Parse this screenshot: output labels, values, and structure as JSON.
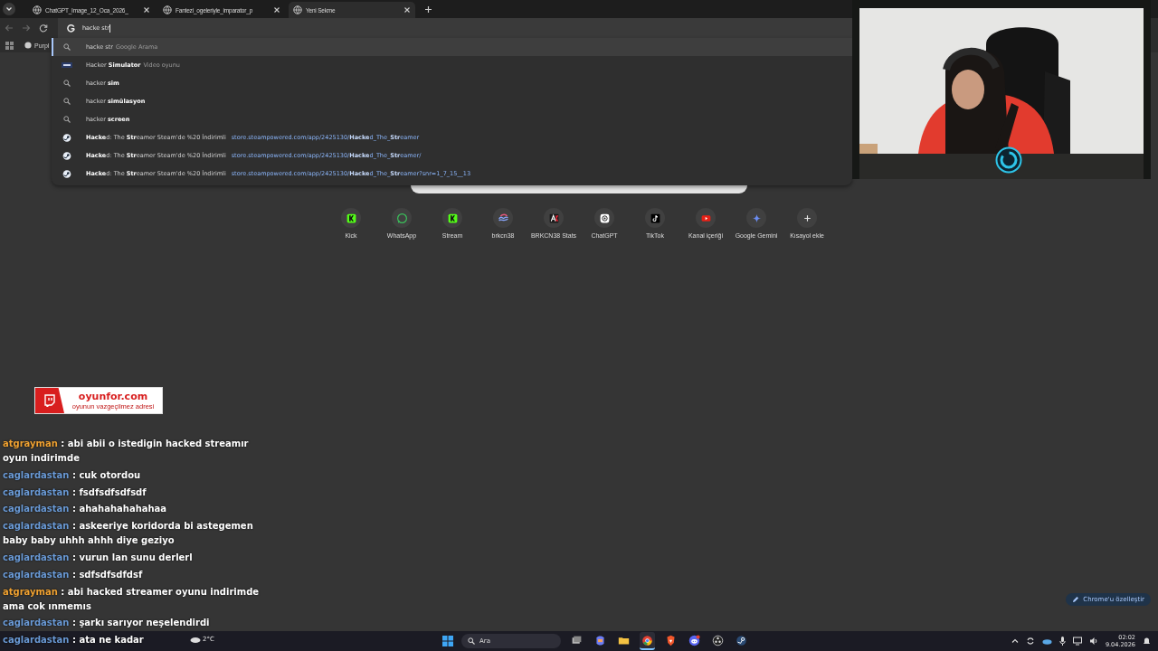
{
  "browser": {
    "tabs": [
      {
        "title": "ChatGPT_Image_12_Oca_2026_",
        "selected": false
      },
      {
        "title": "Fantezi_ogeleriyle_imparator_p",
        "selected": false
      },
      {
        "title": "Yeni Sekme",
        "selected": true
      }
    ],
    "omnibox": {
      "value": "hacke str"
    },
    "bookmarks": [
      {
        "label": "Purpl"
      }
    ],
    "suggestions": [
      {
        "kind": "search",
        "selected": true,
        "text": "hacke str",
        "detail": "Google Arama"
      },
      {
        "kind": "entity",
        "selected": false,
        "text": "Hacker **Simulator**",
        "detail": "Video oyunu"
      },
      {
        "kind": "search",
        "selected": false,
        "text": "hacker **sim**"
      },
      {
        "kind": "search",
        "selected": false,
        "text": "hacker **simülasyon**"
      },
      {
        "kind": "search",
        "selected": false,
        "text": "hacker **screen**"
      },
      {
        "kind": "site",
        "selected": false,
        "text": "**Hacke**d: The **Str**eamer Steam'de %20 İndirimli",
        "url": "store.steampowered.com/app/2425130/**Hacke**d_The_**Str**eamer"
      },
      {
        "kind": "site",
        "selected": false,
        "text": "**Hacke**d: The **Str**eamer Steam'de %20 İndirimli",
        "url": "store.steampowered.com/app/2425130/**Hacke**d_The_**Str**eamer/"
      },
      {
        "kind": "site",
        "selected": false,
        "text": "**Hacke**d: The **Str**eamer Steam'de %20 İndirimli",
        "url": "store.steampowered.com/app/2425130/**Hacke**d_The_**Str**eamer?snr=1_7_15__13"
      }
    ]
  },
  "new_tab": {
    "shortcuts": [
      {
        "kind": "kick",
        "label": "Kick"
      },
      {
        "kind": "whatsapp",
        "label": "WhatsApp"
      },
      {
        "kind": "kick",
        "label": "Stream"
      },
      {
        "kind": "swirl",
        "label": "brkcn38"
      },
      {
        "kind": "stats",
        "label": "BRKCN38 Stats"
      },
      {
        "kind": "chatgpt",
        "label": "ChatGPT"
      },
      {
        "kind": "tiktok",
        "label": "TikTok"
      },
      {
        "kind": "youtube",
        "label": "Kanal içeriği"
      },
      {
        "kind": "gemini",
        "label": "Google Gemini"
      },
      {
        "kind": "add",
        "label": "Kısayol ekle"
      }
    ],
    "customize_button": "Chrome'u özelleştir"
  },
  "stream_overlay": {
    "sponsor": {
      "name": "oyunfor.com",
      "tagline": "oyunun vazgeçilmez adresi"
    },
    "chat": [
      {
        "user": "atgrayman",
        "color": "#f0a232",
        "text": ": abi abii o istedigin hacked streamır oyun indirimde"
      },
      {
        "user": "caglardastan",
        "color": "#6a9ad6",
        "text": ": cuk otordou"
      },
      {
        "user": "caglardastan",
        "color": "#6a9ad6",
        "text": ": fsdfsdfsdfsdf"
      },
      {
        "user": "caglardastan",
        "color": "#6a9ad6",
        "text": ": ahahahahahahaa"
      },
      {
        "user": "caglardastan",
        "color": "#6a9ad6",
        "text": ": askeeriye koridorda bi astegemen baby baby uhhh ahhh diye geziyo"
      },
      {
        "user": "caglardastan",
        "color": "#6a9ad6",
        "text": ": vurun lan sunu derlerl"
      },
      {
        "user": "caglardastan",
        "color": "#6a9ad6",
        "text": ": sdfsdfsdfdsf"
      },
      {
        "user": "atgrayman",
        "color": "#f0a232",
        "text": ": abi hacked streamer oyunu indirimde ama cok ınmemıs"
      },
      {
        "user": "caglardastan",
        "color": "#6a9ad6",
        "text": ": şarkı sarıyor neşelendirdi"
      },
      {
        "user": "caglardastan",
        "color": "#6a9ad6",
        "text": ": ata ne kadar"
      }
    ]
  },
  "taskbar": {
    "weather": "2°C",
    "search": {
      "placeholder": "Ara"
    },
    "apps": [
      {
        "kind": "taskview",
        "active": false
      },
      {
        "kind": "copilot",
        "active": false
      },
      {
        "kind": "folder",
        "active": false
      },
      {
        "kind": "chrome",
        "active": true
      },
      {
        "kind": "brave",
        "active": false
      },
      {
        "kind": "discord",
        "active": false
      },
      {
        "kind": "obs",
        "active": false
      },
      {
        "kind": "steam",
        "active": false
      }
    ],
    "time": "02:02",
    "date": "9.04.2026"
  }
}
